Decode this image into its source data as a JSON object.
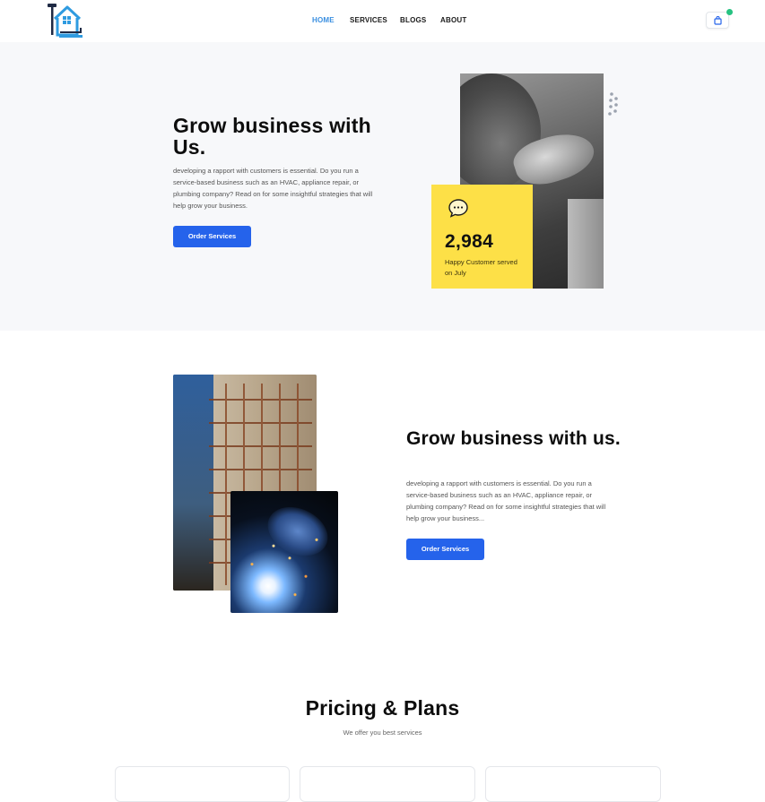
{
  "header": {
    "logo_icon": "house-tools-logo",
    "nav": [
      {
        "label": "HOME",
        "active": true
      },
      {
        "label": "SERVICES",
        "active": false
      },
      {
        "label": "BLOGS",
        "active": false
      },
      {
        "label": "ABOUT",
        "active": false
      }
    ],
    "cart_icon": "shopping-bag-icon",
    "cart_indicator_color": "#26c281",
    "active_nav_color": "#3a8fe0"
  },
  "hero": {
    "title": "Grow business with Us.",
    "description": "developing a rapport with customers is essential. Do you run a service-based business such as an HVAC, appliance repair, or plumbing company? Read on for some insightful strategies that will help grow your business.",
    "button_label": "Order Services",
    "stat": {
      "icon": "chat-bubble-icon",
      "number": "2,984",
      "caption": "Happy Customer served on July"
    }
  },
  "section2": {
    "title": "Grow business with us.",
    "description": "developing a rapport with customers is essential. Do you run a service-based business such as an HVAC, appliance repair, or plumbing company? Read on for some insightful strategies that will help grow your business...",
    "button_label": "Order Services"
  },
  "pricing": {
    "title": "Pricing & Plans",
    "subtitle": "We offer you best services"
  },
  "colors": {
    "primary": "#2563eb",
    "accent_yellow": "#fde047",
    "hero_bg": "#f7f8fa"
  }
}
